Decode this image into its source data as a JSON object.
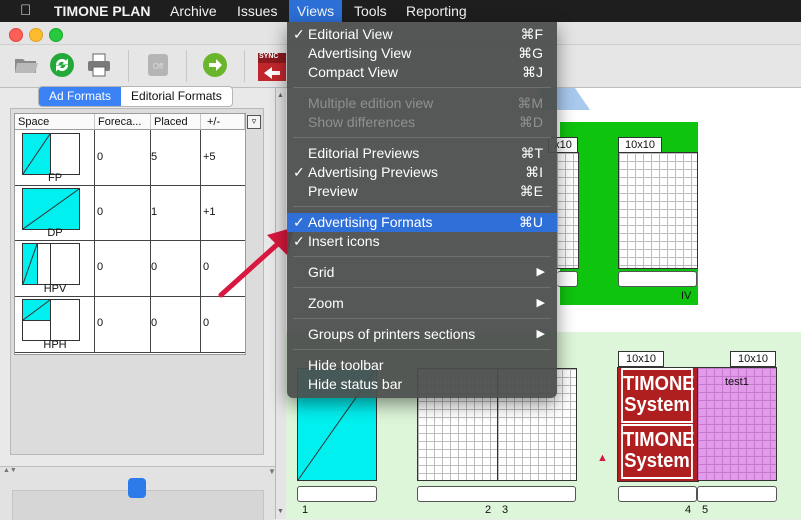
{
  "menubar": {
    "app": "TIMONE PLAN",
    "items": [
      "Archive",
      "Issues",
      "Views",
      "Tools",
      "Reporting"
    ]
  },
  "toolbar": {
    "sync_label": "SYNC"
  },
  "left_panel": {
    "tabs": [
      "Ad Formats",
      "Editorial Formats"
    ],
    "active_tab": "Ad Formats",
    "columns": [
      "Space",
      "Foreca...",
      "Placed",
      "+/-"
    ],
    "rows": [
      {
        "format": "FP",
        "forecast": "0",
        "placed": "5",
        "diff": "+5"
      },
      {
        "format": "DP",
        "forecast": "0",
        "placed": "1",
        "diff": "+1"
      },
      {
        "format": "HPV",
        "forecast": "0",
        "placed": "0",
        "diff": "0"
      },
      {
        "format": "HPH",
        "forecast": "0",
        "placed": "0",
        "diff": "0"
      }
    ]
  },
  "views_menu": {
    "items": [
      {
        "label": "Editorial View",
        "shortcut": "⌘F",
        "checked": true
      },
      {
        "label": "Advertising View",
        "shortcut": "⌘G"
      },
      {
        "label": "Compact View",
        "shortcut": "⌘J"
      },
      {
        "label": "Multiple edition view",
        "shortcut": "⌘M",
        "disabled": true
      },
      {
        "label": "Show differences",
        "shortcut": "⌘D",
        "disabled": true
      },
      {
        "label": "Editorial Previews",
        "shortcut": "⌘T"
      },
      {
        "label": "Advertising Previews",
        "shortcut": "⌘I",
        "checked": true
      },
      {
        "label": "Preview",
        "shortcut": "⌘E"
      },
      {
        "label": "Advertising Formats",
        "shortcut": "⌘U",
        "checked": true,
        "highlighted": true
      },
      {
        "label": "Insert icons",
        "shortcut": "",
        "checked": true
      },
      {
        "label": "Grid",
        "submenu": true
      },
      {
        "label": "Zoom",
        "submenu": true
      },
      {
        "label": "Groups of printers sections",
        "submenu": true
      },
      {
        "label": "Hide toolbar",
        "shortcut": ""
      },
      {
        "label": "Hide status bar",
        "shortcut": ""
      }
    ]
  },
  "pages": {
    "top_labels": [
      "x10",
      "10x10"
    ],
    "top_section_numeral": "IV",
    "bottom_labels": [
      "10x10",
      "10x10"
    ],
    "ad_text": "test1",
    "timone_line1": "TIMONE",
    "timone_line2": "System",
    "page_numbers": [
      "1",
      "2",
      "3",
      "4",
      "5"
    ]
  },
  "colors": {
    "accent": "#2f6fd8",
    "section_green": "#0fc40f",
    "light_green": "#ddf5d8",
    "ad_cyan": "#00f0f0",
    "ad_pink": "#e19be8",
    "timone_red": "#b01f1f",
    "arrow_red": "#d8183e"
  }
}
